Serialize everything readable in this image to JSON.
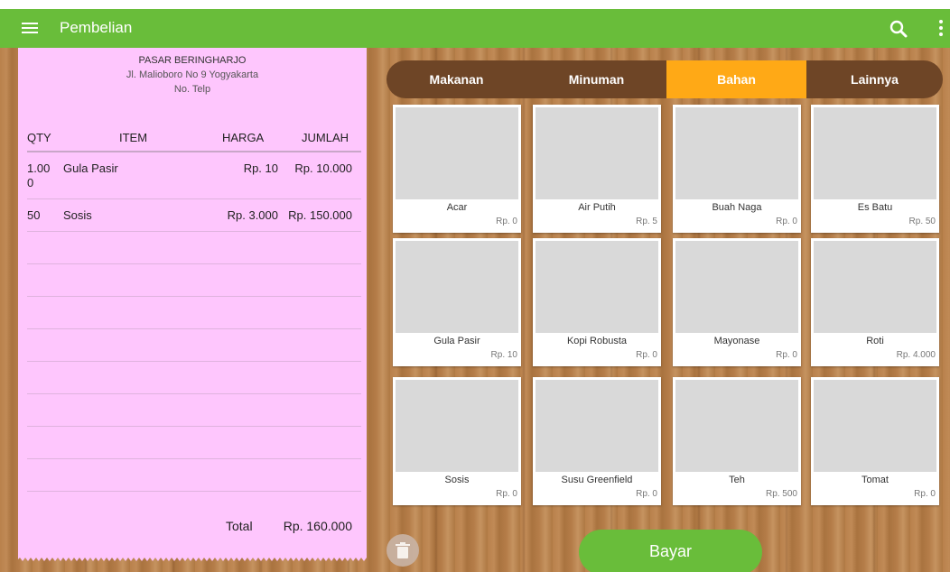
{
  "appbar": {
    "title": "Pembelian",
    "menu_icon": "menu-icon",
    "search_icon": "search-icon",
    "overflow_icon": "more-vert-icon",
    "color": "#69bd3a"
  },
  "receipt": {
    "store_name": "PASAR BERINGHARJO",
    "address": "Jl. Malioboro No 9 Yogyakarta",
    "phone": "No. Telp",
    "headers": {
      "qty": "QTY",
      "item": "ITEM",
      "harga": "HARGA",
      "jumlah": "JUMLAH"
    },
    "rows": [
      {
        "qty": "1.000",
        "item": "Gula Pasir",
        "harga": "Rp. 10",
        "jumlah": "Rp. 10.000"
      },
      {
        "qty": "50",
        "item": "Sosis",
        "harga": "Rp. 3.000",
        "jumlah": "Rp. 150.000"
      }
    ],
    "total_label": "Total",
    "total_value": "Rp. 160.000",
    "background": "#fec6fd"
  },
  "tabs": [
    {
      "label": "Makanan",
      "active": false
    },
    {
      "label": "Minuman",
      "active": false
    },
    {
      "label": "Bahan",
      "active": true
    },
    {
      "label": "Lainnya",
      "active": false
    }
  ],
  "products": [
    {
      "name": "Acar",
      "price": "Rp. 0"
    },
    {
      "name": "Air Putih",
      "price": "Rp. 5"
    },
    {
      "name": "Buah Naga",
      "price": "Rp. 0"
    },
    {
      "name": "Es Batu",
      "price": "Rp. 50"
    },
    {
      "name": "Gula Pasir",
      "price": "Rp. 10"
    },
    {
      "name": "Kopi Robusta",
      "price": "Rp. 0"
    },
    {
      "name": "Mayonase",
      "price": "Rp. 0"
    },
    {
      "name": "Roti",
      "price": "Rp. 4.000"
    },
    {
      "name": "Sosis",
      "price": "Rp. 0"
    },
    {
      "name": "Susu Greenfield",
      "price": "Rp. 0"
    },
    {
      "name": "Teh",
      "price": "Rp. 500"
    },
    {
      "name": "Tomat",
      "price": "Rp. 0"
    }
  ],
  "actions": {
    "pay_label": "Bayar",
    "trash_icon": "trash-icon",
    "accent_color": "#ffa916"
  }
}
